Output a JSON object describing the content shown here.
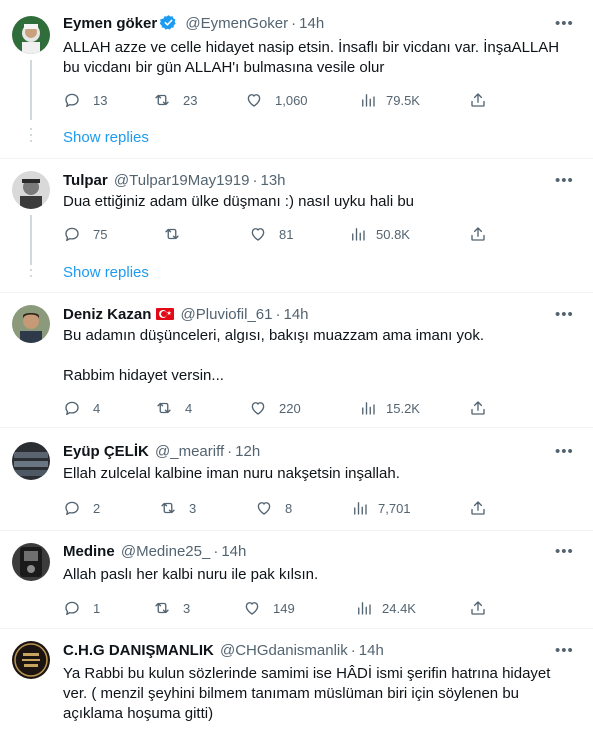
{
  "colors": {
    "link": "#1d9bf0",
    "muted": "#536471",
    "text": "#0f1419",
    "divider": "#eff3f4",
    "verified": "#1d9bf0"
  },
  "tweets": [
    {
      "name": "Eymen göker",
      "handle": "@EymenGoker",
      "time": "14h",
      "verified": true,
      "text": "ALLAH azze ve celle hidayet nasip etsin. İnsaflı bir vicdanı var. İnşaALLAH bu vicdanı bir gün ALLAH'ı bulmasına vesile olur",
      "replies": "13",
      "retweets": "23",
      "likes": "1,060",
      "views": "79.5K",
      "show_replies": "Show replies"
    },
    {
      "name": "Tulpar",
      "handle": "@Tulpar19May1919",
      "time": "13h",
      "text": "Dua ettiğiniz adam ülke düşmanı :) nasıl uyku hali bu",
      "replies": "75",
      "retweets": "",
      "likes": "81",
      "views": "50.8K",
      "show_replies": "Show replies"
    },
    {
      "name": "Deniz Kazan",
      "handle": "@Pluviofil_61",
      "time": "14h",
      "flag": "turkey-flag",
      "text": "Bu adamın düşünceleri, algısı, bakışı muazzam ama imanı yok.\n\nRabbim hidayet versin...",
      "replies": "4",
      "retweets": "4",
      "likes": "220",
      "views": "15.2K"
    },
    {
      "name": "Eyüp ÇELİK",
      "handle": "@_meariff",
      "time": "12h",
      "text": "Ellah zulcelal kalbine iman nuru nakşetsin inşallah.",
      "replies": "2",
      "retweets": "3",
      "likes": "8",
      "views": "7,701"
    },
    {
      "name": "Medine",
      "handle": "@Medine25_",
      "time": "14h",
      "text": "Allah paslı her kalbi nuru ile pak kılsın.",
      "replies": "1",
      "retweets": "3",
      "likes": "149",
      "views": "24.4K"
    },
    {
      "name": "C.H.G DANIŞMANLIK",
      "handle": "@CHGdanismanlik",
      "time": "14h",
      "text": "Ya Rabbi bu kulun sözlerinde samimi ise HÂDİ ismi şerifin hatrına hidayet ver. ( menzil şeyhini bilmem tanımam müslüman biri için söylenen bu açıklama hoşuma gitti)"
    }
  ],
  "icons": {
    "more": "more-icon",
    "reply": "reply-icon",
    "retweet": "retweet-icon",
    "like": "like-icon",
    "views": "views-icon",
    "share": "share-icon",
    "verified": "verified-badge-icon"
  }
}
